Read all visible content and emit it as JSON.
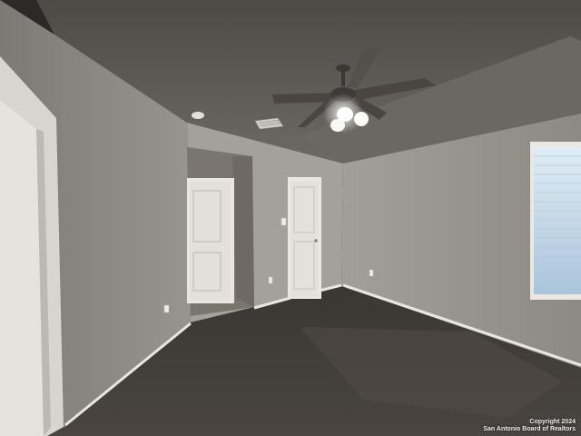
{
  "scene": {
    "description_text": "",
    "watermark": {
      "line1": "Copyright 2024",
      "line2": "San Antonio Board of Realtors"
    },
    "colors": {
      "ceiling": "#5e5b56",
      "wall_left": "#8c8b85",
      "wall_back": "#a3a199",
      "wall_right": "#9b9890",
      "floor": "#3e3a35",
      "door": "#e6e3dc",
      "trim": "#e9e6df",
      "window_glass": "#c9dcea"
    },
    "icons": [
      "ceiling-fan-icon",
      "smoke-detector-icon",
      "air-vent-icon",
      "light-switch-icon",
      "outlet-icon"
    ]
  }
}
